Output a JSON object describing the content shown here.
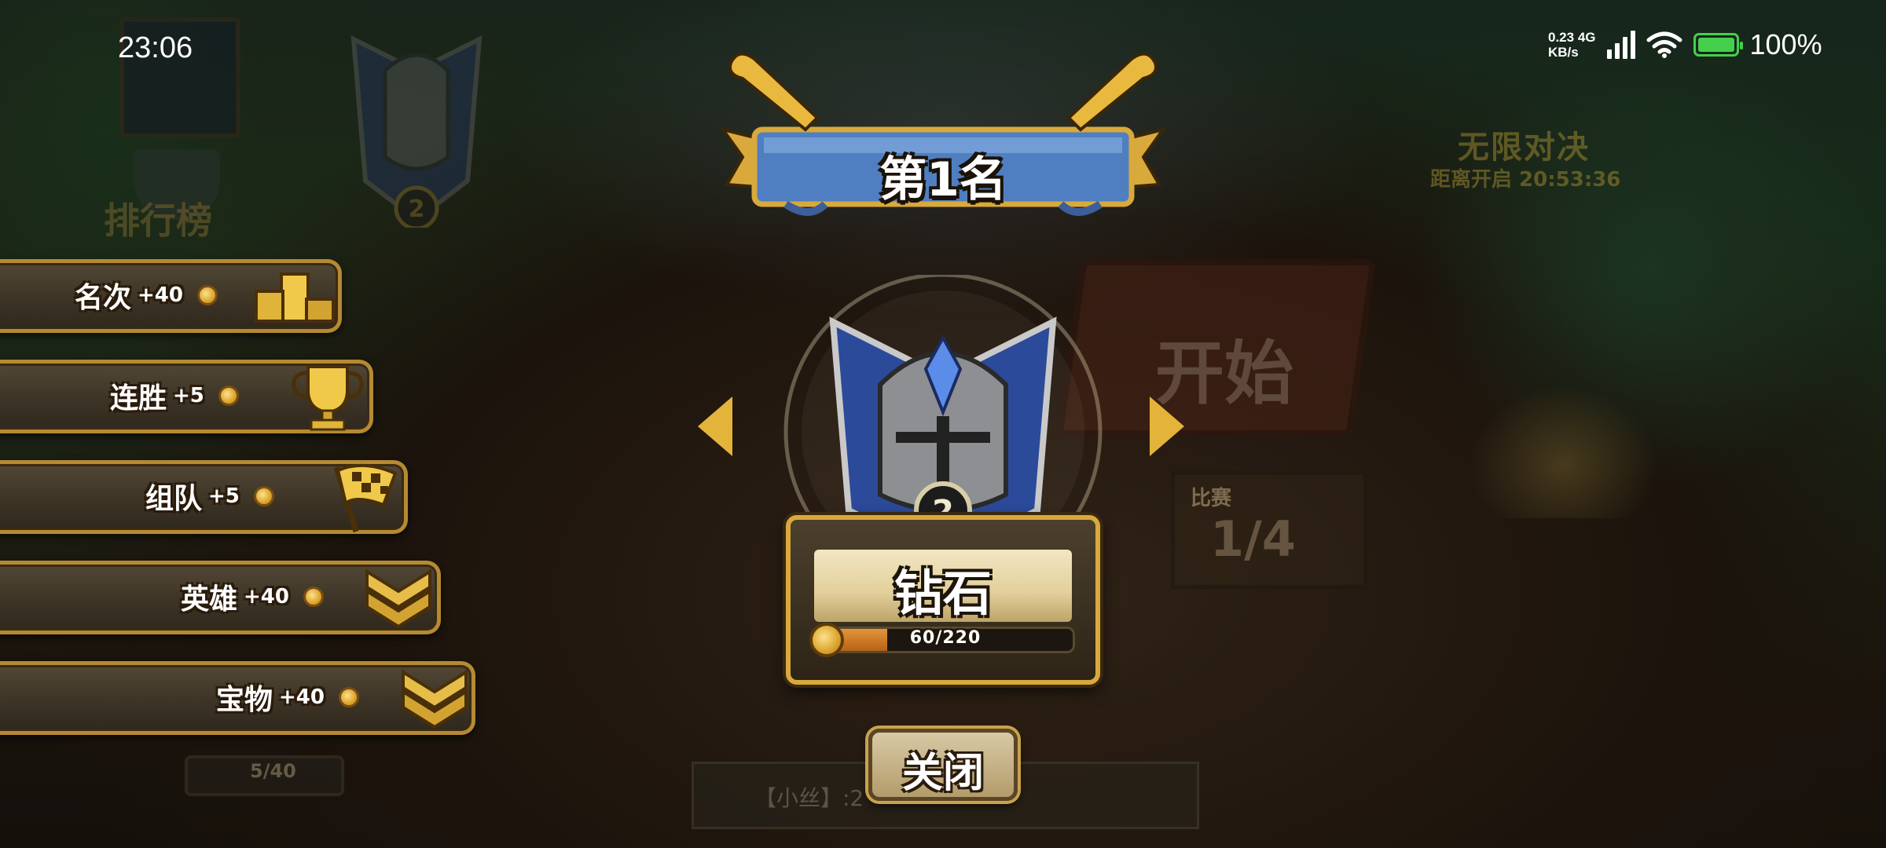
{
  "status_bar": {
    "time": "23:06",
    "net_speed_value": "0.23",
    "net_speed_unit": "KB/s",
    "network_type": "4G",
    "battery_percent": "100%",
    "battery_level": 1.0
  },
  "background": {
    "mode_title": "无限对决",
    "countdown": "距离开启 20:53:36",
    "start_sign": "开始",
    "match_label": "比赛",
    "match_progress": "1/4",
    "rank_board_label": "排行榜",
    "rank_badge_number": "2",
    "bottom_progress": "5/40",
    "chat_text": "【小丝】:2"
  },
  "rewards": [
    {
      "label": "名次",
      "bonus": "+40",
      "icon": "podium-icon"
    },
    {
      "label": "连胜",
      "bonus": "+5",
      "icon": "trophy-icon"
    },
    {
      "label": "组队",
      "bonus": "+5",
      "icon": "checkered-flag-icon"
    },
    {
      "label": "英雄",
      "bonus": "+40",
      "icon": "chevron-rank-icon"
    },
    {
      "label": "宝物",
      "bonus": "+40",
      "icon": "chevron-rank-icon"
    }
  ],
  "popup": {
    "placement_title": "第1名",
    "tier_number": "2",
    "tier_name": "钻石",
    "progress_text": "60/220",
    "progress_fraction": 0.2727,
    "close_label": "关闭",
    "accent_gold": "#d9a93c",
    "banner_blue": "#4f7fc0"
  }
}
